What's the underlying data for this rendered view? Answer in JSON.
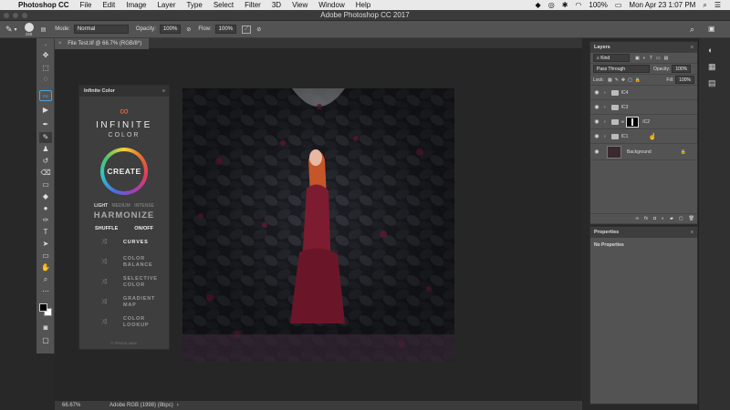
{
  "menubar": {
    "app": "Photoshop CC",
    "menus": [
      "File",
      "Edit",
      "Image",
      "Layer",
      "Type",
      "Select",
      "Filter",
      "3D",
      "View",
      "Window",
      "Help"
    ],
    "battery": "100%",
    "clock": "Mon Apr 23  1:07 PM"
  },
  "window": {
    "title": "Adobe Photoshop CC 2017"
  },
  "options": {
    "brush_size": "150",
    "mode_label": "Mode:",
    "mode_value": "Normal",
    "opacity_label": "Opacity:",
    "opacity_value": "100%",
    "flow_label": "Flow:",
    "flow_value": "100%"
  },
  "document": {
    "tab_title": "File Test.tif @ 66.7% (RGB/8*)",
    "close_glyph": "×"
  },
  "status": {
    "zoom": "66.67%",
    "profile": "Adobe RGB (1998) (8bpc)"
  },
  "infinite_color": {
    "panel_title": "Infinite Color",
    "menu_glyph": "≡",
    "logo_glyph": "∞",
    "brand_top": "INFINITE",
    "brand_bottom": "COLOR",
    "create_label": "CREATE",
    "intensity": [
      "LIGHT",
      "MEDIUM",
      "INTENSE"
    ],
    "harmonize_label": "HARMONIZE",
    "shuffle_label": "SHUFFLE",
    "toggle_label": "ON/OFF",
    "adjustments": [
      "CURVES",
      "COLOR\nBALANCE",
      "SELECTIVE\nCOLOR",
      "GRADIENT\nMAP",
      "COLOR\nLOOKUP"
    ],
    "credit": "© PRATIK NAIK"
  },
  "layers_panel": {
    "tab": "Layers",
    "menu_glyph": "≡",
    "filter_label": "Kind",
    "blend_mode": "Pass Through",
    "opacity_label": "Opacity:",
    "opacity_value": "100%",
    "lock_label": "Lock:",
    "fill_label": "Fill:",
    "fill_value": "100%",
    "layers": [
      {
        "name": "IC4",
        "type": "group"
      },
      {
        "name": "IC3",
        "type": "group"
      },
      {
        "name": "IC2",
        "type": "group-mask"
      },
      {
        "name": "IC1",
        "type": "group"
      },
      {
        "name": "Background",
        "type": "image"
      }
    ]
  },
  "properties_panel": {
    "tab": "Properties",
    "menu_glyph": "≡",
    "message": "No Properties"
  },
  "colors": {
    "accent_ring": [
      "#f4d13a",
      "#e23b5e",
      "#9c3fb7",
      "#4a6fe0",
      "#2ec4c9",
      "#55c46a"
    ],
    "ui_gray": "#535353"
  }
}
